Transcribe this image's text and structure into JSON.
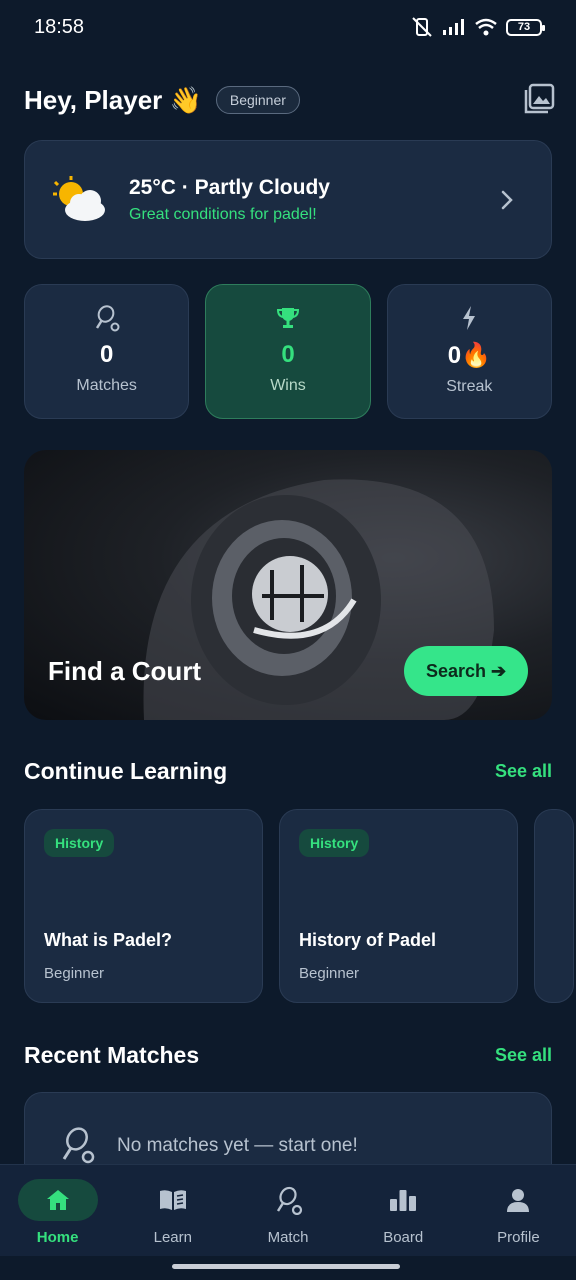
{
  "status_bar": {
    "time": "18:58",
    "battery": "73"
  },
  "header": {
    "greeting": "Hey, Player 👋",
    "level_badge": "Beginner"
  },
  "weather": {
    "title": "25°C · Partly Cloudy",
    "subtitle": "Great conditions for padel!"
  },
  "stats": [
    {
      "value": "0",
      "label": "Matches",
      "icon": "racket-icon"
    },
    {
      "value": "0",
      "label": "Wins",
      "icon": "trophy-icon"
    },
    {
      "value": "0🔥",
      "label": "Streak",
      "icon": "bolt-icon"
    }
  ],
  "hero": {
    "title": "Find a Court",
    "button": "Search ➔"
  },
  "learning": {
    "title": "Continue Learning",
    "see_all": "See all",
    "courses": [
      {
        "tag": "History",
        "title": "What is Padel?",
        "level": "Beginner"
      },
      {
        "tag": "History",
        "title": "History of Padel",
        "level": "Beginner"
      }
    ]
  },
  "matches": {
    "title": "Recent Matches",
    "see_all": "See all",
    "empty": "No matches yet — start one!"
  },
  "nav": [
    {
      "label": "Home",
      "icon": "home-icon",
      "active": true
    },
    {
      "label": "Learn",
      "icon": "book-icon"
    },
    {
      "label": "Match",
      "icon": "racket-icon"
    },
    {
      "label": "Board",
      "icon": "bar-chart-icon"
    },
    {
      "label": "Profile",
      "icon": "person-icon"
    }
  ],
  "colors": {
    "background": "#0d1a2b",
    "card": "#1b2b42",
    "accent": "#35e07e",
    "active_card": "#164a3e"
  }
}
